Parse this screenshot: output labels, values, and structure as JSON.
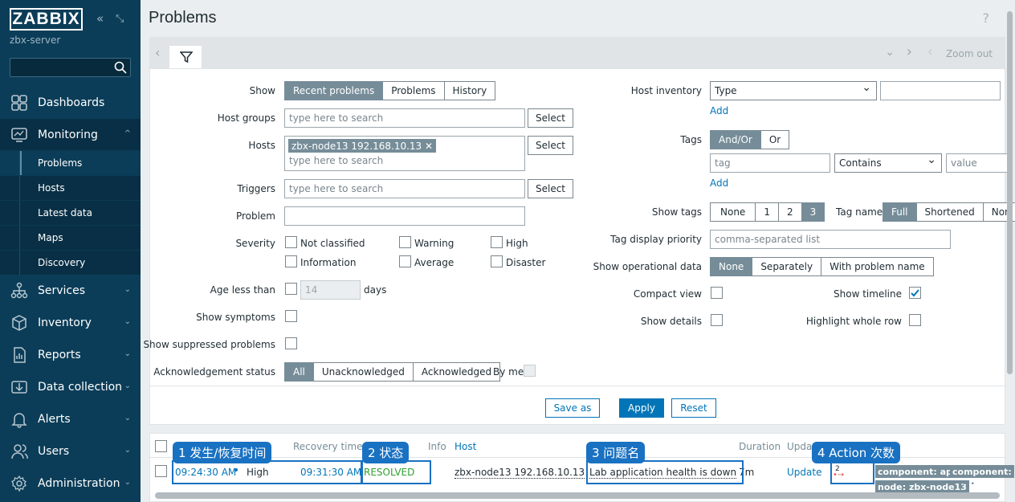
{
  "brand": {
    "logo": "ZABBIX",
    "server": "zbx-server"
  },
  "nav": [
    {
      "label": "Dashboards",
      "icon": "dashboard-icon"
    },
    {
      "label": "Monitoring",
      "icon": "monitoring-icon"
    },
    {
      "label": "Services",
      "icon": "services-icon"
    },
    {
      "label": "Inventory",
      "icon": "inventory-icon"
    },
    {
      "label": "Reports",
      "icon": "reports-icon"
    },
    {
      "label": "Data collection",
      "icon": "data-collection-icon"
    },
    {
      "label": "Alerts",
      "icon": "alerts-icon"
    },
    {
      "label": "Users",
      "icon": "users-icon"
    },
    {
      "label": "Administration",
      "icon": "administration-icon"
    }
  ],
  "monitoring_sub": [
    "Problems",
    "Hosts",
    "Latest data",
    "Maps",
    "Discovery"
  ],
  "page": {
    "title": "Problems",
    "help": "?",
    "zoom_out": "Zoom out"
  },
  "filter": {
    "show_label": "Show",
    "show_options": [
      "Recent problems",
      "Problems",
      "History"
    ],
    "host_groups_label": "Host groups",
    "hosts_label": "Hosts",
    "triggers_label": "Triggers",
    "problem_label": "Problem",
    "placeholder": "type here to search",
    "select": "Select",
    "host_tag": "zbx-node13 192.168.10.13",
    "severity_label": "Severity",
    "severities": [
      "Not classified",
      "Warning",
      "High",
      "Information",
      "Average",
      "Disaster"
    ],
    "age_label": "Age less than",
    "age_value": "14",
    "age_unit": "days",
    "show_symptoms": "Show symptoms",
    "show_suppressed": "Show suppressed problems",
    "ack_label": "Acknowledgement status",
    "ack_options": [
      "All",
      "Unacknowledged",
      "Acknowledged"
    ],
    "by_me": "By me",
    "host_inventory_label": "Host inventory",
    "inventory_type": "Type",
    "add": "Add",
    "tags_label": "Tags",
    "tags_options": [
      "And/Or",
      "Or"
    ],
    "tag_placeholder": "tag",
    "tag_op": "Contains",
    "value_placeholder": "value",
    "show_tags_label": "Show tags",
    "show_tags_options": [
      "None",
      "1",
      "2",
      "3"
    ],
    "tag_name_label": "Tag name",
    "tag_name_options": [
      "Full",
      "Shortened",
      "Non"
    ],
    "tag_priority_label": "Tag display priority",
    "tag_priority_placeholder": "comma-separated list",
    "opdata_label": "Show operational data",
    "opdata_options": [
      "None",
      "Separately",
      "With problem name"
    ],
    "compact_label": "Compact view",
    "timeline_label": "Show timeline",
    "details_label": "Show details",
    "highlight_label": "Highlight whole row",
    "save_as": "Save as",
    "apply": "Apply",
    "reset": "Reset"
  },
  "table": {
    "headers": {
      "recovery": "Recovery time",
      "info": "Info",
      "host": "Host",
      "duration": "Duration",
      "update": "Upda"
    },
    "row": {
      "time": "09:24:30 AM",
      "severity": "High",
      "recovery": "09:31:30 AM",
      "status": "RESOLVED",
      "host": "zbx-node13 192.168.10.13",
      "problem": "Lab application health is down",
      "duration": "7m",
      "update": "Update",
      "actions": "2",
      "tag1": "component: app",
      "tag2": "component:",
      "tag3": "node: zbx-node13",
      "more": "•••"
    }
  },
  "annotations": [
    "1 发生/恢复时间",
    "2 状态",
    "3 问题名",
    "4 Action 次数"
  ],
  "colors": {
    "sidebar": "#0b3d58",
    "accent": "#0275b8",
    "resolved": "#2f9f2f",
    "annotation": "#1971c2"
  }
}
